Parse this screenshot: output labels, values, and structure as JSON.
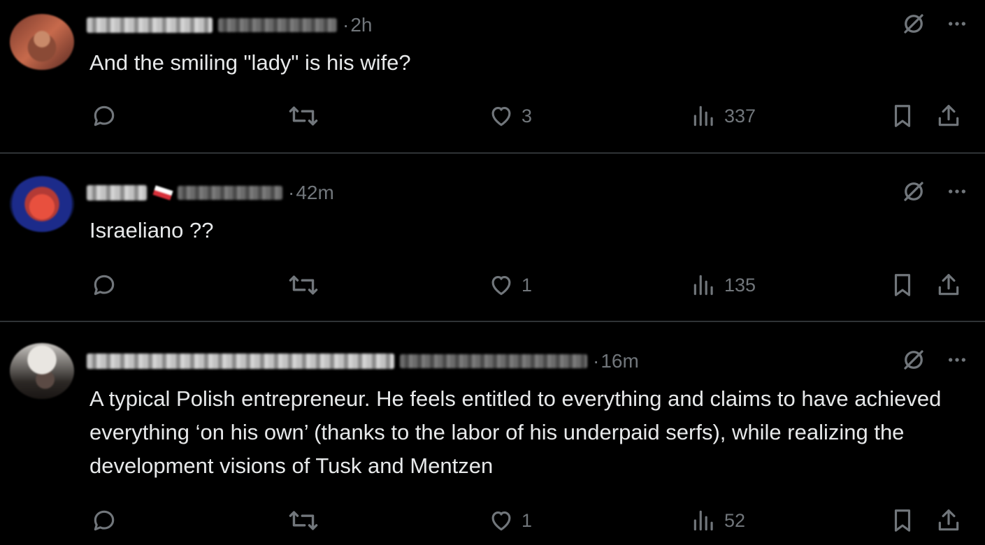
{
  "posts": [
    {
      "time": "2h",
      "text": "And the smiling \"lady\" is his wife?",
      "stats": {
        "replies": "",
        "reposts": "",
        "likes": "3",
        "views": "337"
      }
    },
    {
      "time": "42m",
      "text": "Israeliano ??",
      "stats": {
        "replies": "",
        "reposts": "",
        "likes": "1",
        "views": "135"
      }
    },
    {
      "time": "16m",
      "text": "A typical Polish entrepreneur. He feels entitled to everything and claims to have achieved everything ‘on his own’ (thanks to the labor of his underpaid serfs), while realizing the development visions of Tusk and Mentzen",
      "stats": {
        "replies": "",
        "reposts": "",
        "likes": "1",
        "views": "52"
      }
    }
  ],
  "header": {
    "separator": "·"
  },
  "icons": {
    "reply": "reply-icon",
    "repost": "repost-icon",
    "like": "heart-icon",
    "views": "views-icon",
    "bookmark": "bookmark-icon",
    "share": "share-icon",
    "grok": "grok-icon",
    "more": "more-icon"
  },
  "colors": {
    "background": "#000000",
    "text": "#e7e9ea",
    "muted": "#71767b",
    "divider": "#2f3336"
  }
}
